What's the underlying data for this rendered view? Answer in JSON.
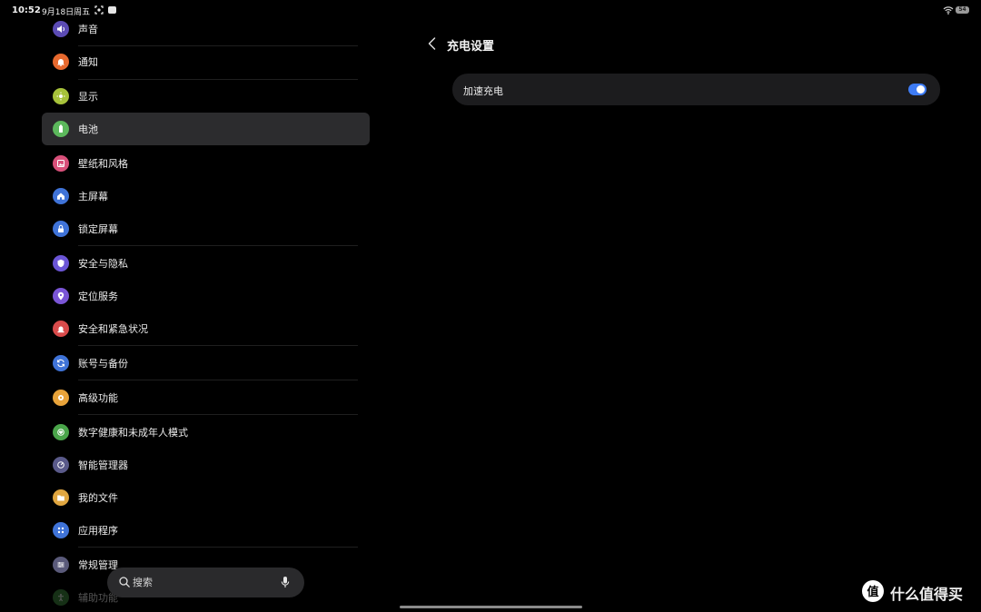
{
  "status_bar": {
    "time": "10:52",
    "date": "9月18日周五",
    "battery_label": "54"
  },
  "sidebar": {
    "items": [
      {
        "label": "声音",
        "icon": "speaker-icon",
        "color": "#5b4bb4"
      },
      {
        "label": "通知",
        "icon": "bell-icon",
        "color": "#e7692e"
      },
      {
        "label": "显示",
        "icon": "sun-icon",
        "color": "#a7c23a"
      },
      {
        "label": "电池",
        "icon": "battery-icon",
        "color": "#5cb85c"
      },
      {
        "label": "壁纸和风格",
        "icon": "picture-icon",
        "color": "#d9507a"
      },
      {
        "label": "主屏幕",
        "icon": "home-icon",
        "color": "#3f73d8"
      },
      {
        "label": "锁定屏幕",
        "icon": "lock-icon",
        "color": "#3f73d8"
      },
      {
        "label": "安全与隐私",
        "icon": "shield-icon",
        "color": "#6b55d6"
      },
      {
        "label": "定位服务",
        "icon": "location-icon",
        "color": "#7a55d6"
      },
      {
        "label": "安全和紧急状况",
        "icon": "alert-icon",
        "color": "#d94b4b"
      },
      {
        "label": "账号与备份",
        "icon": "sync-icon",
        "color": "#3f73d8"
      },
      {
        "label": "高级功能",
        "icon": "gear-star-icon",
        "color": "#e8a33a"
      },
      {
        "label": "数字健康和未成年人模式",
        "icon": "heart-icon",
        "color": "#4aa54a"
      },
      {
        "label": "智能管理器",
        "icon": "gauge-icon",
        "color": "#5a5a8a"
      },
      {
        "label": "我的文件",
        "icon": "folder-icon",
        "color": "#e0a640"
      },
      {
        "label": "应用程序",
        "icon": "apps-icon",
        "color": "#3f73d8"
      },
      {
        "label": "常规管理",
        "icon": "sliders-icon",
        "color": "#5a5a7a"
      },
      {
        "label": "辅助功能",
        "icon": "accessibility-icon",
        "color": "#3f8a3f"
      }
    ]
  },
  "search": {
    "placeholder": "搜索"
  },
  "detail": {
    "title": "充电设置",
    "settings": [
      {
        "label": "加速充电",
        "enabled": true
      }
    ]
  },
  "watermark": {
    "logo_text": "值",
    "text": "什么值得买"
  },
  "colors": {
    "accent": "#3e7cf5",
    "card": "#1c1c1e",
    "active_item": "#2c2c2e"
  }
}
